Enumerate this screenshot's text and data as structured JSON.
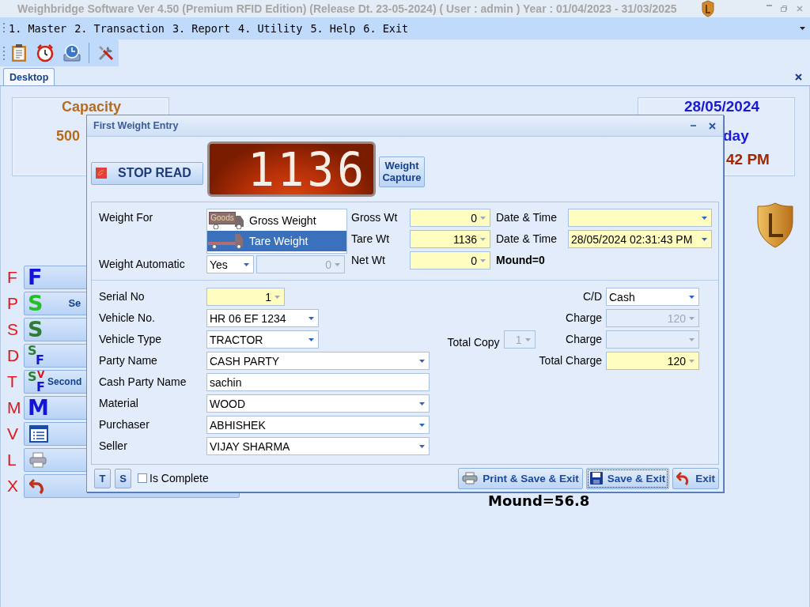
{
  "window": {
    "title": "Weighbridge Software Ver 4.50 (Premium RFID Edition) (Release Dt. 23-05-2024)  ( User : admin ) Year : 01/04/2023 - 31/03/2025"
  },
  "menu": [
    {
      "label": "1. Master"
    },
    {
      "label": "2. Transaction"
    },
    {
      "label": "3. Report"
    },
    {
      "label": "4. Utility"
    },
    {
      "label": "5. Help"
    },
    {
      "label": "6. Exit"
    }
  ],
  "tabs": [
    {
      "label": "Desktop",
      "selected": true
    }
  ],
  "desktop": {
    "capacity_card": {
      "title": "Capacity",
      "value": "500"
    },
    "date_card": {
      "date": "28/05/2024",
      "day": "day",
      "time": "42 PM"
    },
    "shortcuts": [
      {
        "key": "F",
        "kind": "letters",
        "parts": [
          {
            "text": "F",
            "color": "#1414d8"
          }
        ]
      },
      {
        "key": "P",
        "kind": "letters",
        "parts": [
          {
            "text": "S",
            "color": "#22c022"
          }
        ],
        "label": "Se"
      },
      {
        "key": "S",
        "kind": "letters",
        "parts": [
          {
            "text": "S",
            "color": "#2e7d32"
          }
        ]
      },
      {
        "key": "D",
        "kind": "letters",
        "parts": [
          {
            "text": "S",
            "color": "#2e7d32"
          },
          {
            "text": "F",
            "color": "#1414d8"
          }
        ]
      },
      {
        "key": "T",
        "kind": "letters",
        "parts": [
          {
            "text": "S",
            "color": "#2e7d32"
          },
          {
            "text": "V",
            "color": "#e01010"
          },
          {
            "text": "F",
            "color": "#1414d8"
          }
        ],
        "label": "Second"
      },
      {
        "key": "M",
        "kind": "letters",
        "parts": [
          {
            "text": "M",
            "color": "#1414d8"
          }
        ]
      },
      {
        "key": "V",
        "kind": "list"
      },
      {
        "key": "L",
        "kind": "printer"
      },
      {
        "key": "X",
        "kind": "undo"
      }
    ],
    "mound": "Mound=56.8"
  },
  "dialog": {
    "title": "First Weight Entry",
    "stop_read": "STOP READ",
    "reading": "1136",
    "capture": "Weight Capture",
    "weight_for": {
      "label": "Weight For",
      "options": [
        {
          "label": "Gross Weight",
          "badge": "Goods",
          "selected": false
        },
        {
          "label": "Tare Weight",
          "selected": true
        }
      ]
    },
    "weight_automatic": {
      "label": "Weight Automatic",
      "value": "Yes",
      "count": "0"
    },
    "weights": [
      {
        "label": "Gross Wt",
        "value": "0",
        "date_label": "Date & Time"
      },
      {
        "label": "Tare Wt",
        "value": "1136",
        "date_label": "Date & Time",
        "date": "28/05/2024 02:31:43 PM"
      },
      {
        "label": "Net Wt",
        "value": "0",
        "note": "Mound=0"
      }
    ],
    "fields": [
      {
        "label": "Serial No",
        "value": "1",
        "kind": "serial"
      },
      {
        "label": "Vehicle No.",
        "value": "HR 06 EF 1234",
        "kind": "short"
      },
      {
        "label": "Vehicle Type",
        "value": "TRACTOR",
        "kind": "short"
      },
      {
        "label": "Party Name",
        "value": "CASH PARTY",
        "kind": "combo"
      },
      {
        "label": "Cash Party Name",
        "value": "sachin",
        "kind": "text"
      },
      {
        "label": "Material",
        "value": "WOOD",
        "kind": "combo"
      },
      {
        "label": "Purchaser",
        "value": "ABHISHEK",
        "kind": "combo"
      },
      {
        "label": "Seller",
        "value": "VIJAY SHARMA",
        "kind": "combo"
      }
    ],
    "billing": [
      {
        "label": "C/D",
        "value": "Cash",
        "kind": "combo",
        "disabled": false
      },
      {
        "label": "Charge",
        "value": "120",
        "kind": "combo",
        "disabled": true
      },
      {
        "label": "Charge",
        "kind": "combo",
        "disabled": true,
        "copy": {
          "label": "Total Copy",
          "value": "1"
        }
      },
      {
        "label": "Total Charge",
        "value": "120",
        "kind": "total",
        "disabled": false
      }
    ],
    "mini_buttons": [
      "T",
      "S"
    ],
    "is_complete": {
      "label": "Is Complete",
      "checked": false
    },
    "actions": [
      {
        "label": "Print & Save & Exit",
        "kind": "print",
        "focused": false
      },
      {
        "label": "Save & Exit",
        "kind": "save",
        "focused": true
      },
      {
        "label": "Exit",
        "kind": "exit",
        "focused": false
      }
    ]
  }
}
